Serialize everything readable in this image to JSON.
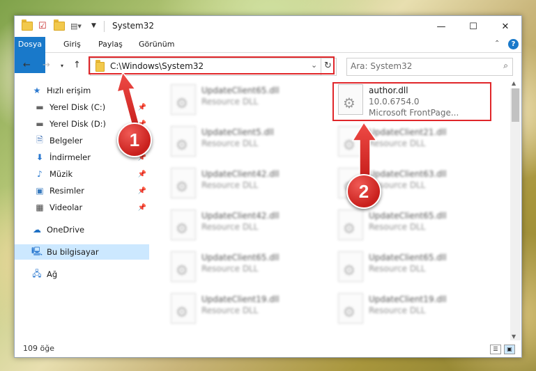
{
  "window": {
    "title": "System32",
    "controls": {
      "minimize": "—",
      "maximize": "☐",
      "close": "✕"
    }
  },
  "ribbon": {
    "tabs": [
      "Dosya",
      "Giriş",
      "Paylaş",
      "Görünüm"
    ],
    "collapse_icon": "chevron-up-icon",
    "help_label": "?"
  },
  "address_bar": {
    "path": "C:\\Windows\\System32",
    "search_placeholder": "Ara: System32"
  },
  "nav_pane": {
    "quick_access": "Hızlı erişim",
    "items": [
      {
        "label": "Yerel Disk (C:)",
        "icon": "drive-icon",
        "pinned": true
      },
      {
        "label": "Yerel Disk (D:)",
        "icon": "drive-icon",
        "pinned": true
      },
      {
        "label": "Belgeler",
        "icon": "documents-icon",
        "pinned": true
      },
      {
        "label": "İndirmeler",
        "icon": "download-icon",
        "pinned": true
      },
      {
        "label": "Müzik",
        "icon": "music-icon",
        "pinned": true
      },
      {
        "label": "Resimler",
        "icon": "pictures-icon",
        "pinned": true
      },
      {
        "label": "Videolar",
        "icon": "videos-icon",
        "pinned": true
      }
    ],
    "onedrive": "OneDrive",
    "this_pc": "Bu bilgisayar",
    "network": "Ağ"
  },
  "files": {
    "highlighted": {
      "name": "author.dll",
      "version": "10.0.6754.0",
      "description": "Microsoft FrontPage..."
    },
    "left_column": [
      {
        "name": "UpdateClient65.dll",
        "type": "Resource DLL"
      },
      {
        "name": "UpdateClient5.dll",
        "type": "Resource DLL"
      },
      {
        "name": "UpdateClient42.dll",
        "type": "Resource DLL"
      },
      {
        "name": "UpdateClient42.dll",
        "type": "Resource DLL"
      },
      {
        "name": "UpdateClient65.dll",
        "type": "Resource DLL"
      },
      {
        "name": "UpdateClient19.dll",
        "type": "Resource DLL"
      }
    ],
    "right_column": [
      {
        "name": "UpdateClient21.dll",
        "type": "Resource DLL"
      },
      {
        "name": "UpdateClient63.dll",
        "type": "Resource DLL"
      },
      {
        "name": "UpdateClient65.dll",
        "type": "Resource DLL"
      },
      {
        "name": "UpdateClient65.dll",
        "type": "Resource DLL"
      },
      {
        "name": "UpdateClient19.dll",
        "type": "Resource DLL"
      }
    ]
  },
  "status_bar": {
    "item_count": "109 öğe"
  },
  "annotations": {
    "step1": "1",
    "step2": "2",
    "accent": "#e0262a"
  }
}
